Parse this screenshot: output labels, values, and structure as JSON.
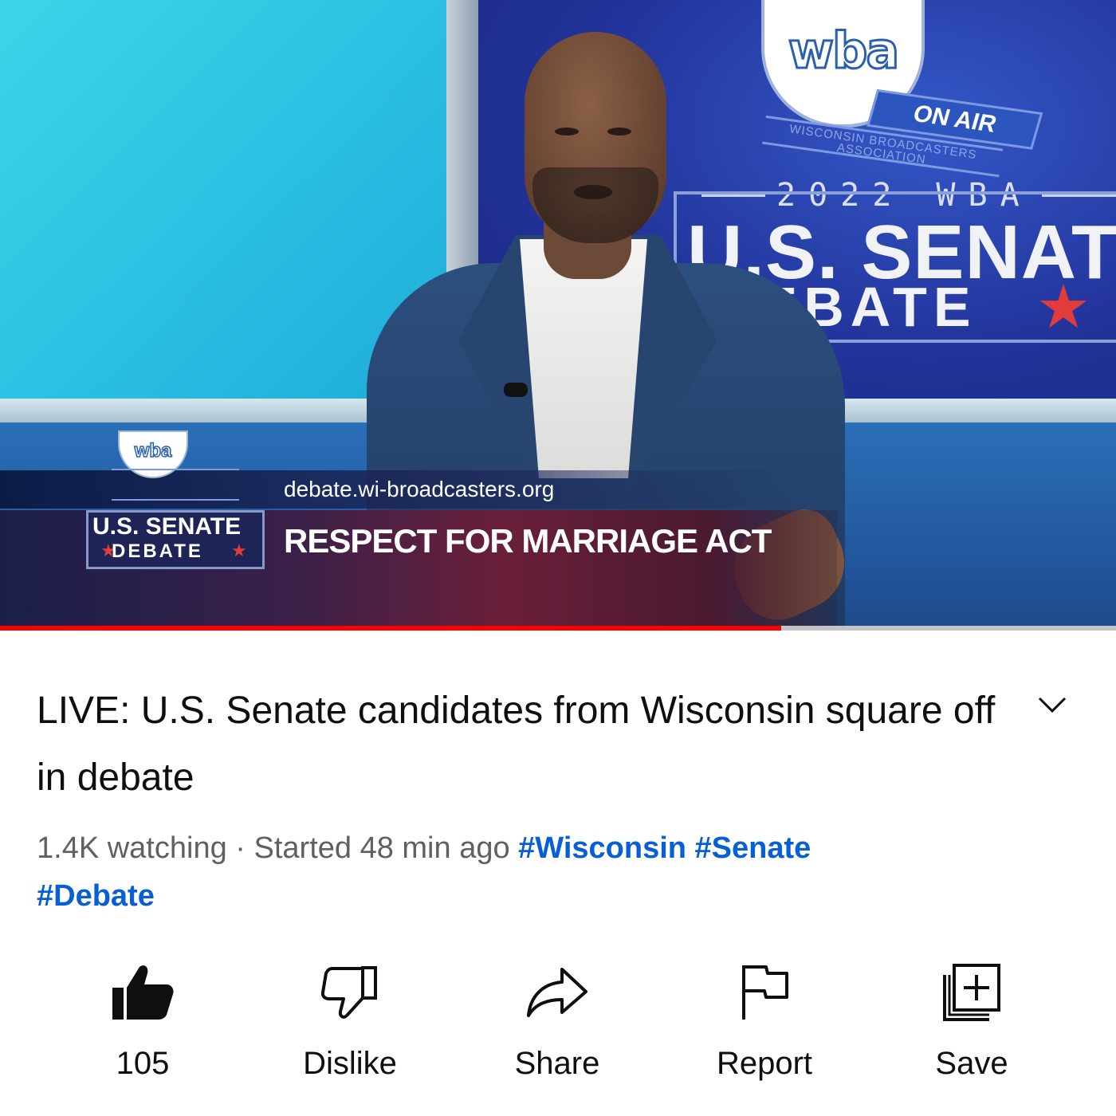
{
  "video": {
    "logo_text": "wba",
    "on_air": "ON AIR",
    "association": "WISCONSIN BROADCASTERS ASSOCIATION",
    "year_line": "2022 WBA",
    "senate_title": "U.S. SENATE",
    "debate_title": "DEBATE",
    "lower_third": {
      "logo_senate": "U.S. SENATE",
      "logo_debate": "DEBATE",
      "url": "debate.wi-broadcasters.org",
      "headline": "RESPECT FOR MARRIAGE ACT"
    },
    "progress_fraction": 0.7
  },
  "info": {
    "title": "LIVE: U.S. Senate candidates from Wisconsin square off in debate",
    "watching": "1.4K watching",
    "separator": " · ",
    "started": "Started 48 min ago",
    "hashtags": [
      "#Wisconsin",
      "#Senate",
      "#Debate"
    ]
  },
  "actions": [
    {
      "icon": "thumbs-up-filled-icon",
      "label": "105"
    },
    {
      "icon": "thumbs-down-icon",
      "label": "Dislike"
    },
    {
      "icon": "share-icon",
      "label": "Share"
    },
    {
      "icon": "flag-icon",
      "label": "Report"
    },
    {
      "icon": "playlist-add-icon",
      "label": "Save"
    }
  ],
  "colors": {
    "progress": "#ff0000",
    "hashtag": "#065fd4",
    "meta": "#606060",
    "text": "#0f0f0f"
  }
}
